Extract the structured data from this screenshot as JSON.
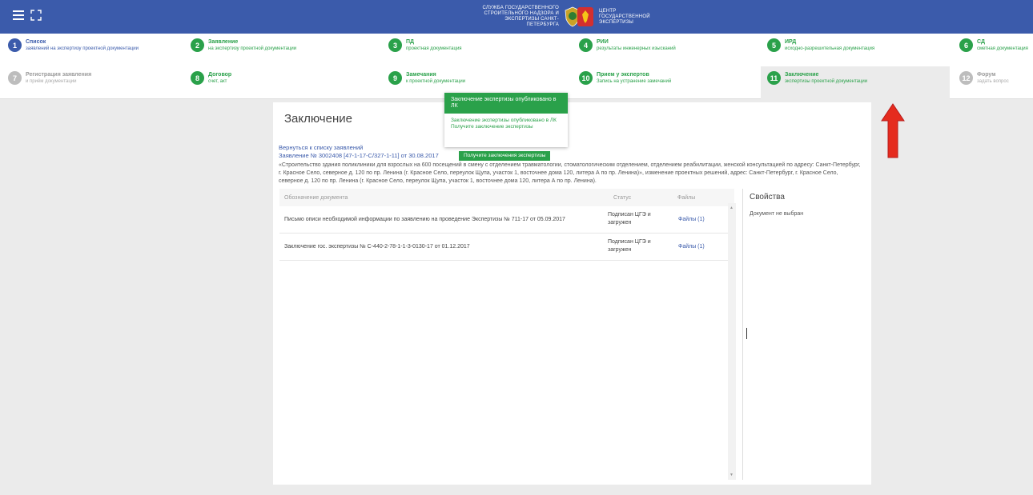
{
  "header": {
    "org_left": [
      "СЛУЖБА ГОСУДАРСТВЕННОГО",
      "СТРОИТЕЛЬНОГО НАДЗОРА И",
      "ЭКСПЕРТИЗЫ САНКТ-ПЕТЕРБУРГА"
    ],
    "org_right": [
      "ЦЕНТР ГОСУДАРСТВЕННОЙ",
      "ЭКСПЕРТИЗЫ"
    ],
    "colors": {
      "bar": "#3b5bab",
      "accent_green": "#2aa14a"
    }
  },
  "steps": [
    {
      "num": "1",
      "title": "Список",
      "subtitle": "заявлений на экспертизу проектной документации"
    },
    {
      "num": "2",
      "title": "Заявление",
      "subtitle": "на экспертизу проектной документации"
    },
    {
      "num": "3",
      "title": "ПД",
      "subtitle": "проектная документация"
    },
    {
      "num": "4",
      "title": "РИИ",
      "subtitle": "результаты инженерных изысканий"
    },
    {
      "num": "5",
      "title": "ИРД",
      "subtitle": "исходно-разрешительная документация"
    },
    {
      "num": "6",
      "title": "СД",
      "subtitle": "сметная документация"
    },
    {
      "num": "7",
      "title": "Регистрация заявления",
      "subtitle": "и приём документации"
    },
    {
      "num": "8",
      "title": "Договор",
      "subtitle": "счет, акт"
    },
    {
      "num": "9",
      "title": "Замечания",
      "subtitle": "к проектной документации"
    },
    {
      "num": "10",
      "title": "Прием у экспертов",
      "subtitle": "Запись на устранение замечаний"
    },
    {
      "num": "11",
      "title": "Заключение",
      "subtitle": "экспертизы проектной документации"
    },
    {
      "num": "12",
      "title": "Форум",
      "subtitle": "задать вопрос"
    }
  ],
  "main": {
    "title": "Заключение",
    "back_link": "Вернуться к списку заявлений",
    "application_line": "Заявление № 3002408 [47-1-17-С/327-1-11] от 30.08.2017",
    "get_conclusion_button": "Получите заключения экспертизы",
    "description": "«Строительство здания поликлиники для взрослых на 600 посещений в смену с отделением травматологии, стоматологическим отделением, отделением реабилитации, женской консультацией по адресу: Санкт-Петербург, г. Красное Село, северное д. 120 по пр. Ленина (г. Красное Село, переулок Щупа, участок 1, восточнее дома 120, литера А по пр. Ленина)», изменение проектных решений, адрес: Санкт-Петербург, г. Красное Село, северное д. 120 по пр. Ленина (г. Красное Село, переулок Щупа, участок 1, восточнее дома 120, литера А по пр. Ленина).",
    "table": {
      "columns": [
        "Обозначение документа",
        "Статус",
        "Файлы"
      ],
      "rows": [
        {
          "name": "Письмо описи необходимой информации по заявлению на проведение Экспертизы № 711-17 от 05.09.2017",
          "status": "Подписан ЦГЭ и загружен",
          "files": "Файлы (1)"
        },
        {
          "name": "Заключение гос. экспертизы № С-440-2-78-1-1-3-0130-17 от 01.12.2017",
          "status": "Подписан ЦГЭ и загружен",
          "files": "Файлы (1)"
        }
      ]
    },
    "properties": {
      "title": "Свойства",
      "empty": "Документ не выбран"
    }
  },
  "notification": {
    "heading": "Заключение экспертизы опубликовано в ЛК",
    "line1": "Заключение экспертизы опубликовано в ЛК",
    "line2": "Получите заключение экспертизы"
  }
}
